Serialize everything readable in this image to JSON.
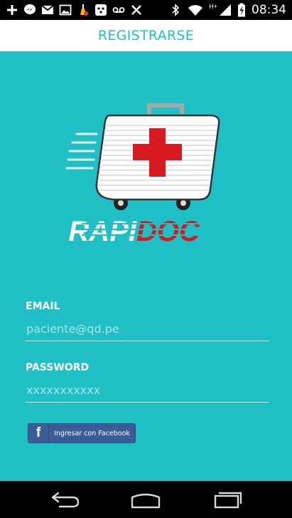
{
  "status_bar": {
    "time": "08:34",
    "network_label": "H+",
    "icons_left": [
      "plus-notification-icon",
      "messenger-icon",
      "gmail-icon",
      "image-icon",
      "cleaner-icon",
      "bbm-icon",
      "voicemail-icon",
      "pinwheel-icon"
    ],
    "icons_right": [
      "bluetooth-icon",
      "wifi-icon",
      "signal-icon",
      "battery-charging-icon"
    ]
  },
  "header": {
    "title": "REGISTRARSE"
  },
  "logo": {
    "wordmark_left": "RAPI",
    "wordmark_right": "DOC"
  },
  "form": {
    "email": {
      "label": "EMAIL",
      "placeholder": "paciente@qd.pe",
      "value": ""
    },
    "password": {
      "label": "PASSWORD",
      "placeholder": "xxxxxxxxxxx",
      "value": ""
    }
  },
  "facebook_button": {
    "label": "Ingresar con Facebook",
    "icon": "f"
  },
  "colors": {
    "background": "#1fbfc6",
    "header_bg": "#ffffff",
    "accent_red": "#d71920",
    "facebook_blue": "#3b5b99"
  }
}
